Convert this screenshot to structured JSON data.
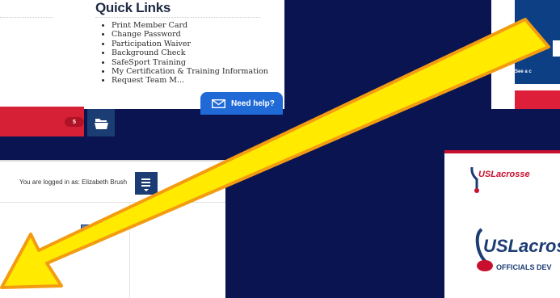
{
  "quick_links": {
    "heading": "Quick Links",
    "items": [
      "Print Member Card",
      "Change Password",
      "Participation Waiver",
      "Background Check",
      "SafeSport Training",
      "My Certification & Training Information",
      "Request Team M..."
    ]
  },
  "help_button": {
    "label": "Need help?"
  },
  "top_right_card": {
    "caption": "See a c"
  },
  "dashboard": {
    "logged_in_text": "You are logged in as: Elizabeth Brush",
    "badge_count": "5"
  },
  "logos": {
    "small_text": "USLacrosse",
    "large_text": "USLacros",
    "large_subtext": "OFFICIALS DEV"
  },
  "colors": {
    "background": "#0a1450",
    "brand_blue": "#1c3d74",
    "brand_red": "#d62035",
    "help_blue": "#1f6ad6",
    "arrow_yellow": "#ffea00"
  },
  "icons": [
    "mail-icon",
    "hamburger-menu-icon",
    "folder-icon",
    "lacrosse-stick-icon",
    "arrow-annotation"
  ]
}
